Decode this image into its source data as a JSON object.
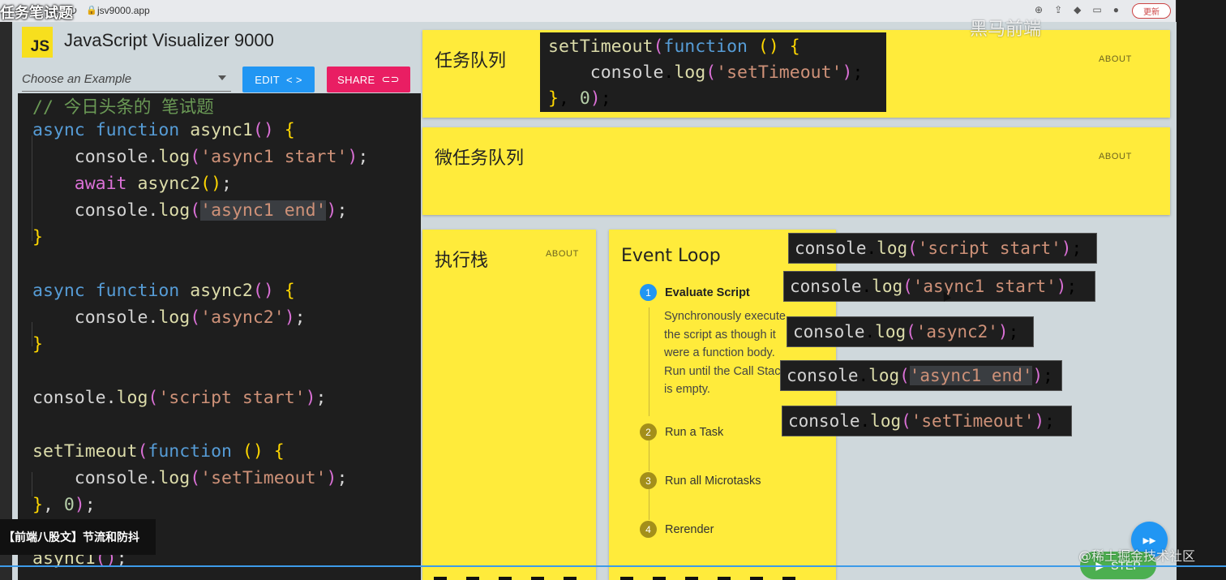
{
  "browser": {
    "video_title": "任务笔试题",
    "url": "jsv9000.app",
    "update_label": "更新"
  },
  "app": {
    "title": "JavaScript Visualizer 9000",
    "logo": "JS",
    "example_placeholder": "Choose an Example",
    "edit_label": "EDIT",
    "share_label": "SHARE"
  },
  "editor": {
    "comment": "// 今日头条的 笔试题",
    "lines": {
      "l1_kw1": "async",
      "l1_kw2": "function",
      "l1_fn": "async1",
      "l2_obj": "console",
      "l2_fn": "log",
      "l2_str": "'async1 start'",
      "l3_kw": "await",
      "l3_fn": "async2",
      "l4_str": "'async1 end'",
      "l6_fn": "async2",
      "l7_str": "'async2'",
      "l9_str": "'script start'",
      "l10_fn": "setTimeout",
      "l10_kw": "function",
      "l11_str": "'setTimeout'",
      "l12_num": "0",
      "l13_fn": "async1"
    }
  },
  "overlay_banner": "【前端八股文】节流和防抖",
  "panels": {
    "task_queue": "任务队列",
    "microtask_queue": "微任务队列",
    "call_stack": "执行栈",
    "event_loop": "Event Loop",
    "about_label": "ABOUT"
  },
  "task_card": {
    "fn": "setTimeout",
    "kw": "function",
    "str": "'setTimeout'",
    "num": "0"
  },
  "event_loop_steps": [
    {
      "num": "1",
      "label": "Evaluate Script"
    },
    {
      "num": "2",
      "label": "Run a Task"
    },
    {
      "num": "3",
      "label": "Run all Microtasks"
    },
    {
      "num": "4",
      "label": "Rerender"
    }
  ],
  "step1_desc": "Synchronously execute the script as though it were a function body. Run until the Call Stack is empty.",
  "log_cards": [
    "'script start'",
    "'async1 start'",
    "'async2'",
    "'async1 end'",
    "'setTimeout'"
  ],
  "step_button": "STEP",
  "watermarks": {
    "top_right": "黑马前端",
    "bottom_right": "@稀土掘金技术社区"
  },
  "colors": {
    "panel_yellow": "#ffeb3b",
    "edit_blue": "#2196f3",
    "share_pink": "#e91e63",
    "step_green": "#4caf50"
  }
}
